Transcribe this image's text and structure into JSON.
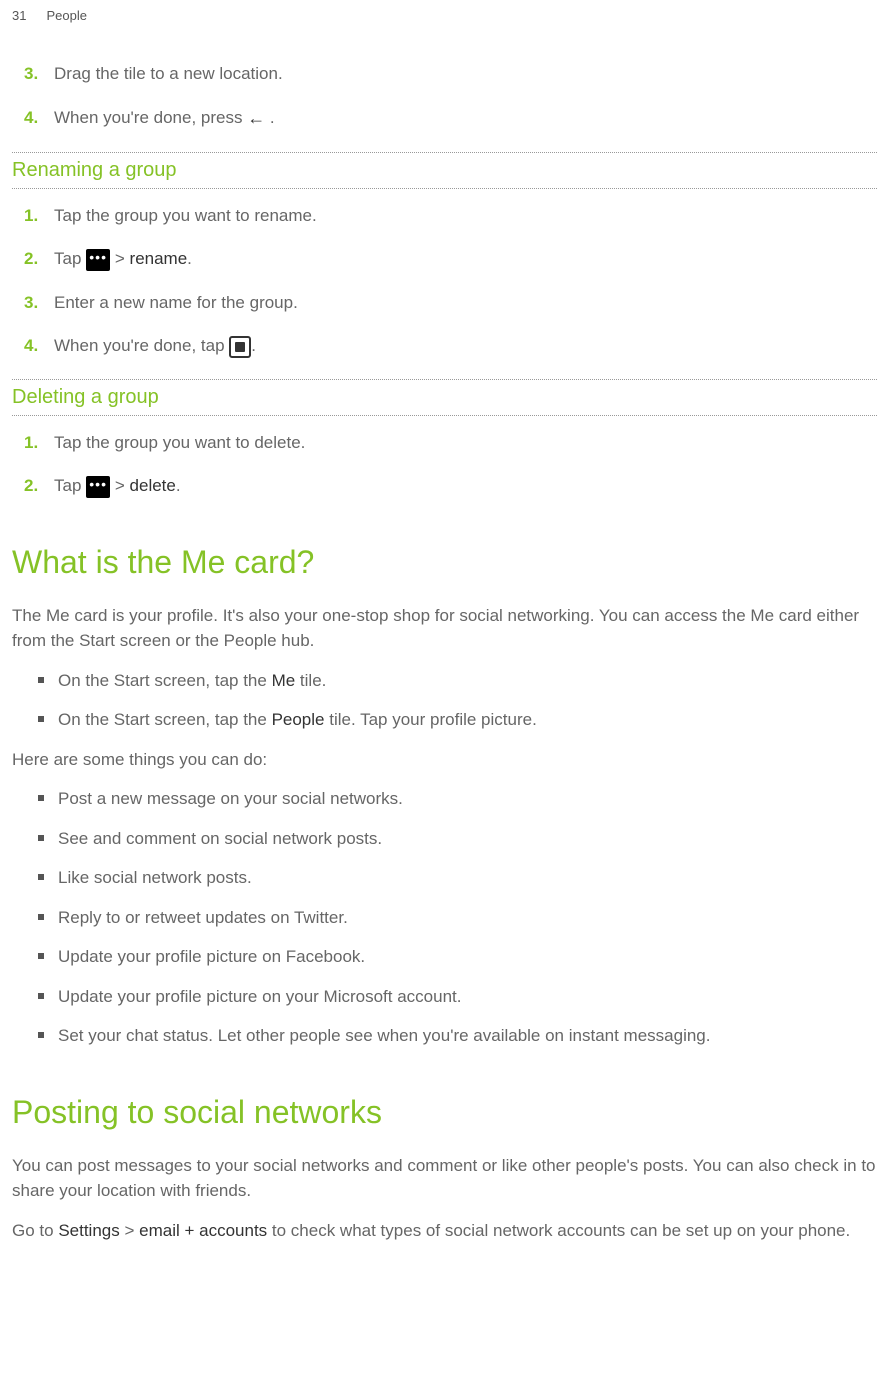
{
  "header": {
    "pageNumber": "31",
    "section": "People"
  },
  "continuedList": {
    "items": [
      {
        "num": "3.",
        "text": "Drag the tile to a new location."
      },
      {
        "num": "4.",
        "textPrefix": "When you're done, press ",
        "textSuffix": " ."
      }
    ]
  },
  "renaming": {
    "heading": "Renaming a group",
    "items": [
      {
        "num": "1.",
        "text": "Tap the group you want to rename."
      },
      {
        "num": "2.",
        "prefix": "Tap ",
        "middle": " > ",
        "bold1": "rename",
        "suffix": "."
      },
      {
        "num": "3.",
        "text": "Enter a new name for the group."
      },
      {
        "num": "4.",
        "prefix": "When you're done, tap ",
        "suffix": "."
      }
    ]
  },
  "deleting": {
    "heading": "Deleting a group",
    "items": [
      {
        "num": "1.",
        "text": "Tap the group you want to delete."
      },
      {
        "num": "2.",
        "prefix": "Tap ",
        "middle": " > ",
        "bold1": "delete",
        "suffix": "."
      }
    ]
  },
  "meCard": {
    "heading": "What is the Me card?",
    "intro": "The Me card is your profile. It's also your one-stop shop for social networking. You can access the Me card either from the Start screen or the People hub.",
    "accessBullets": [
      {
        "prefix": "On the Start screen, tap the ",
        "bold": "Me",
        "suffix": " tile."
      },
      {
        "prefix": "On the Start screen, tap the ",
        "bold": "People",
        "suffix": " tile. Tap your profile picture."
      }
    ],
    "thingsIntro": "Here are some things you can do:",
    "thingsBullets": [
      "Post a new message on your social networks.",
      "See and comment on social network posts.",
      "Like social network posts.",
      "Reply to or retweet updates on Twitter.",
      "Update your profile picture on Facebook.",
      "Update your profile picture on your Microsoft account.",
      "Set your chat status. Let other people see when you're available on instant messaging."
    ]
  },
  "posting": {
    "heading": "Posting to social networks",
    "para1": "You can post messages to your social networks and comment or like other people's posts. You can also check in to share your location with friends.",
    "para2Prefix": "Go to ",
    "para2Bold1": "Settings",
    "para2Mid": " > ",
    "para2Bold2": "email + accounts",
    "para2Suffix": " to check what types of social network accounts can be set up on your phone."
  }
}
